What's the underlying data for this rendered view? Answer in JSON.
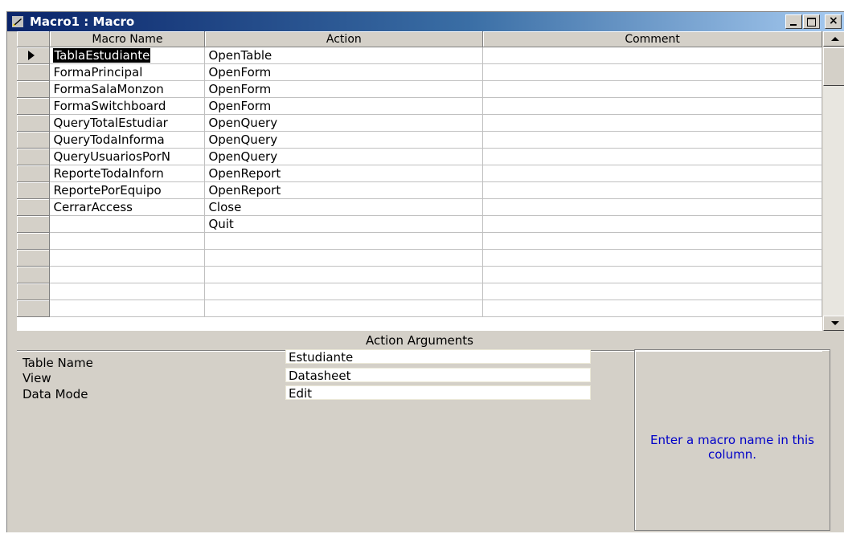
{
  "window": {
    "title": "Macro1 : Macro"
  },
  "grid": {
    "columns": [
      "Macro Name",
      "Action",
      "Comment"
    ],
    "rows": [
      {
        "name": "TablaEstudiante",
        "action": "OpenTable",
        "comment": ""
      },
      {
        "name": "FormaPrincipal",
        "action": "OpenForm",
        "comment": ""
      },
      {
        "name": "FormaSalaMonzon",
        "action": "OpenForm",
        "comment": ""
      },
      {
        "name": "FormaSwitchboard",
        "action": "OpenForm",
        "comment": ""
      },
      {
        "name": "QueryTotalEstudiar",
        "action": "OpenQuery",
        "comment": ""
      },
      {
        "name": "QueryTodaInforma",
        "action": "OpenQuery",
        "comment": ""
      },
      {
        "name": "QueryUsuariosPorN",
        "action": "OpenQuery",
        "comment": ""
      },
      {
        "name": "ReporteTodaInforn",
        "action": "OpenReport",
        "comment": ""
      },
      {
        "name": "ReportePorEquipo",
        "action": "OpenReport",
        "comment": ""
      },
      {
        "name": "CerrarAccess",
        "action": "Close",
        "comment": ""
      },
      {
        "name": "",
        "action": "Quit",
        "comment": ""
      },
      {
        "name": "",
        "action": "",
        "comment": ""
      },
      {
        "name": "",
        "action": "",
        "comment": ""
      },
      {
        "name": "",
        "action": "",
        "comment": ""
      },
      {
        "name": "",
        "action": "",
        "comment": ""
      },
      {
        "name": "",
        "action": "",
        "comment": ""
      }
    ]
  },
  "arguments": {
    "header": "Action Arguments",
    "fields": [
      {
        "label": "Table Name",
        "value": "Estudiante"
      },
      {
        "label": "View",
        "value": "Datasheet"
      },
      {
        "label": "Data Mode",
        "value": "Edit"
      }
    ],
    "help_text": "Enter a macro name in this column."
  },
  "colors": {
    "title_start": "#0a246a",
    "title_end": "#a6caf0",
    "help_text": "#0000c8",
    "face": "#d4d0c8"
  },
  "icons": {
    "title": "macro-icon",
    "min": "minimize-icon",
    "max": "maximize-icon",
    "close": "close-icon"
  }
}
